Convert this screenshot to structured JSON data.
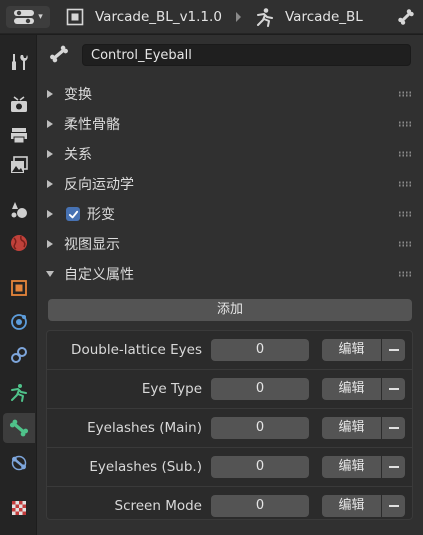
{
  "header": {
    "object_name": "Varcade_BL_v1.1.0",
    "armature_name": "Varcade_BL"
  },
  "bone_name": "Control_Eyeball",
  "panels": [
    {
      "label": "变换",
      "expanded": false,
      "checkbox": false
    },
    {
      "label": "柔性骨骼",
      "expanded": false,
      "checkbox": false
    },
    {
      "label": "关系",
      "expanded": false,
      "checkbox": false
    },
    {
      "label": "反向运动学",
      "expanded": false,
      "checkbox": false
    },
    {
      "label": "形变",
      "expanded": false,
      "checkbox": true
    },
    {
      "label": "视图显示",
      "expanded": false,
      "checkbox": false
    },
    {
      "label": "自定义属性",
      "expanded": true,
      "checkbox": false
    }
  ],
  "custom_props": {
    "add_label": "添加",
    "edit_label": "编辑",
    "items": [
      {
        "name": "Double-lattice Eyes",
        "value": "0"
      },
      {
        "name": "Eye Type",
        "value": "0"
      },
      {
        "name": "Eyelashes (Main)",
        "value": "0"
      },
      {
        "name": "Eyelashes (Sub.)",
        "value": "0"
      },
      {
        "name": "Screen Mode",
        "value": "0"
      }
    ]
  },
  "colors": {
    "accent_blue": "#4772b3",
    "bone_green": "#4fc28a",
    "object_orange": "#e5853b"
  },
  "tabs": [
    "tool-tab",
    "render-tab",
    "output-tab",
    "view-layer-tab",
    "scene-tab",
    "world-tab",
    "object-tab",
    "modifiers-tab",
    "physics-tab",
    "object-data-tab",
    "bone-tab",
    "bone-constraints-tab",
    "texture-tab"
  ]
}
